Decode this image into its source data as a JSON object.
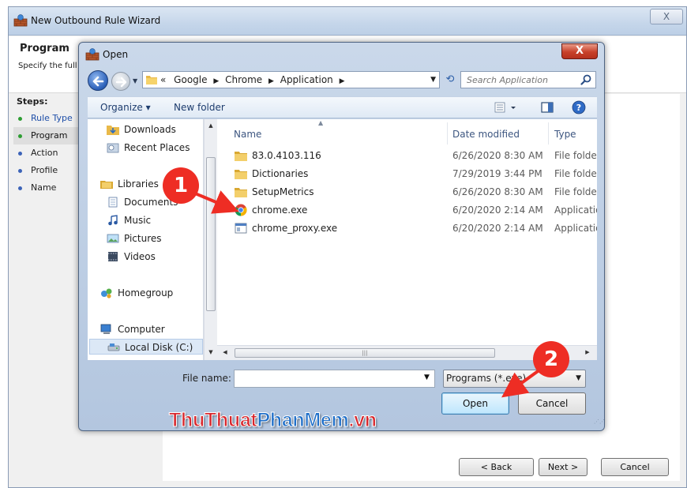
{
  "wizard": {
    "title": "New Outbound Rule Wizard",
    "close_label": "X",
    "header_title": "Program",
    "header_subtitle": "Specify the full p",
    "steps_label": "Steps:",
    "steps": [
      {
        "label": "Rule Type",
        "state": "done"
      },
      {
        "label": "Program",
        "state": "current"
      },
      {
        "label": "Action",
        "state": "pending"
      },
      {
        "label": "Profile",
        "state": "pending"
      },
      {
        "label": "Name",
        "state": "pending"
      }
    ],
    "buttons": {
      "back": "< Back",
      "next": "Next >",
      "cancel": "Cancel"
    }
  },
  "dialog": {
    "title": "Open",
    "close_label": "X",
    "address": {
      "prefix": "«",
      "crumbs": [
        "Google",
        "Chrome",
        "Application"
      ]
    },
    "search_placeholder": "Search Application",
    "toolbar": {
      "organize": "Organize ▾",
      "new_folder": "New folder"
    },
    "nav_items": [
      {
        "label": "Downloads",
        "icon": "downloads-folder-icon"
      },
      {
        "label": "Recent Places",
        "icon": "recent-places-icon"
      },
      {
        "label": "Libraries",
        "icon": "libraries-icon"
      },
      {
        "label": "Documents",
        "icon": "documents-icon"
      },
      {
        "label": "Music",
        "icon": "music-icon"
      },
      {
        "label": "Pictures",
        "icon": "pictures-icon"
      },
      {
        "label": "Videos",
        "icon": "videos-icon"
      },
      {
        "label": "Homegroup",
        "icon": "homegroup-icon"
      },
      {
        "label": "Computer",
        "icon": "computer-icon"
      },
      {
        "label": "Local Disk (C:)",
        "icon": "local-disk-icon"
      }
    ],
    "columns": {
      "name": "Name",
      "date": "Date modified",
      "type": "Type"
    },
    "files": [
      {
        "name": "83.0.4103.116",
        "date": "6/26/2020 8:30 AM",
        "type": "File folder",
        "icon": "folder-icon"
      },
      {
        "name": "Dictionaries",
        "date": "7/29/2019 3:44 PM",
        "type": "File folder",
        "icon": "folder-icon"
      },
      {
        "name": "SetupMetrics",
        "date": "6/26/2020 8:30 AM",
        "type": "File folder",
        "icon": "folder-icon"
      },
      {
        "name": "chrome.exe",
        "date": "6/20/2020 2:14 AM",
        "type": "Application",
        "icon": "chrome-icon"
      },
      {
        "name": "chrome_proxy.exe",
        "date": "6/20/2020 2:14 AM",
        "type": "Application",
        "icon": "exe-icon"
      }
    ],
    "file_name_label": "File name:",
    "file_name_value": "",
    "file_type_value": "Programs (*.exe)",
    "buttons": {
      "open": "Open",
      "cancel": "Cancel"
    }
  },
  "annotations": {
    "badge_1": "1",
    "badge_2": "2",
    "color": "#ee2d24"
  },
  "watermark": {
    "part1": "ThuThuat",
    "part2": "PhanMem",
    "part3": ".vn"
  }
}
